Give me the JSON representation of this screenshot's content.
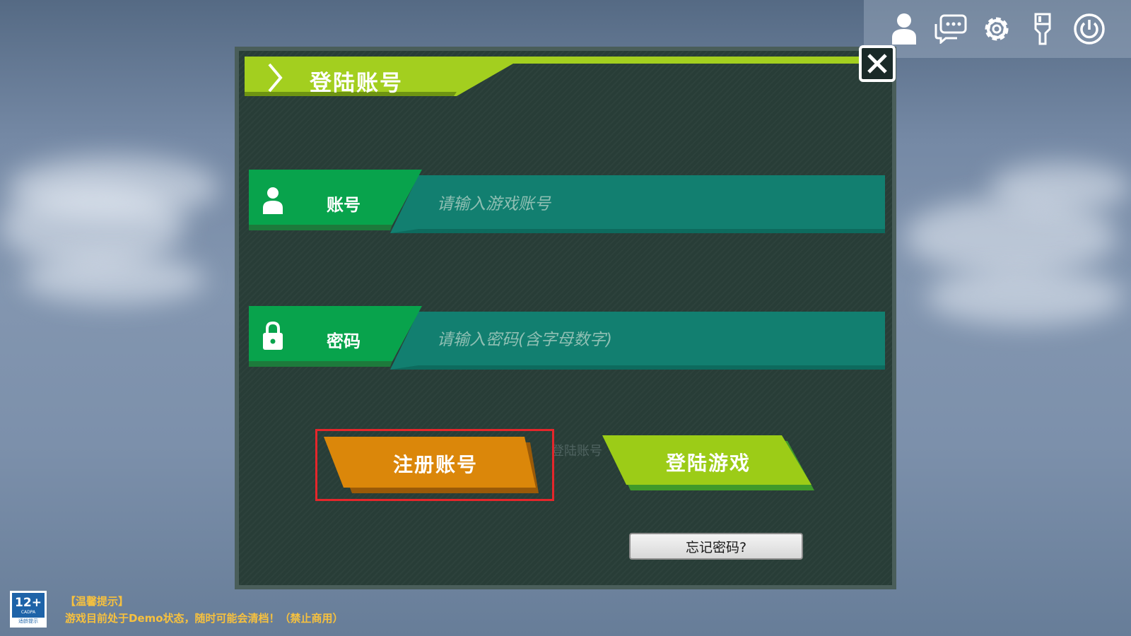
{
  "toolbar": {
    "icons": [
      "user-icon",
      "chat-icon",
      "gear-icon",
      "brush-icon",
      "power-icon"
    ]
  },
  "dialog": {
    "title": "登陆账号",
    "close_icon": "close-icon",
    "account": {
      "label": "账号",
      "placeholder": "请输入游戏账号",
      "icon": "user-icon"
    },
    "password": {
      "label": "密码",
      "placeholder": "请输入密码(含字母数字)",
      "icon": "lock-icon"
    },
    "register_label": "注册账号",
    "ghost_label": "登陆账号",
    "login_label": "登陆游戏",
    "forgot_label": "忘记密码?"
  },
  "age_badge": {
    "rating": "12+",
    "sub": "CADPA",
    "bottom": "适龄提示"
  },
  "notice": {
    "title": "【温馨提示】",
    "text": "游戏目前处于Demo状态，随时可能会清档！（禁止商用）"
  },
  "colors": {
    "title_green": "#a3cf1f",
    "label_green": "#08a34c",
    "input_teal": "#127f70",
    "register_orange": "#db870a",
    "login_green": "#9ccc17",
    "highlight_red": "#e5262b",
    "notice_yellow": "#f7c13e"
  }
}
